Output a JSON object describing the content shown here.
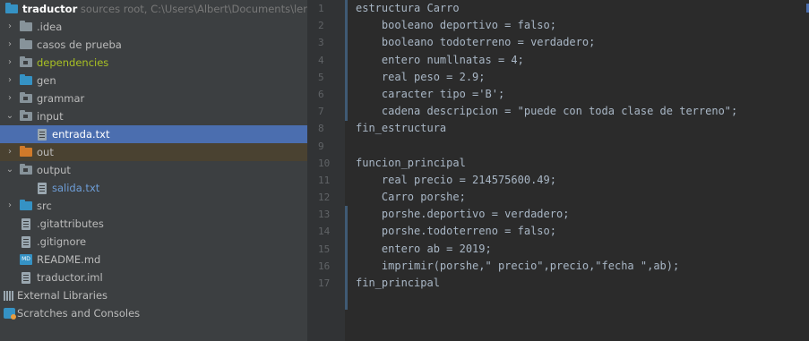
{
  "project_tree": {
    "root": {
      "name": "traductor",
      "path": "sources root, C:\\Users\\Albert\\Documents\\leng"
    },
    "items": [
      {
        "label": "idea",
        "display": ".idea"
      },
      {
        "label": "casos de prueba"
      },
      {
        "label": "dependencies"
      },
      {
        "label": "gen"
      },
      {
        "label": "grammar"
      },
      {
        "label": "input"
      },
      {
        "label": "entrada.txt"
      },
      {
        "label": "out"
      },
      {
        "label": "output"
      },
      {
        "label": "salida.txt"
      },
      {
        "label": "src"
      },
      {
        "label": ".gitattributes"
      },
      {
        "label": ".gitignore"
      },
      {
        "label": "README.md"
      },
      {
        "label": "traductor.iml"
      },
      {
        "label": "External Libraries"
      },
      {
        "label": "Scratches and Consoles"
      }
    ],
    "md_icon_text": "MD"
  },
  "editor": {
    "line_numbers": [
      "1",
      "2",
      "3",
      "4",
      "5",
      "6",
      "7",
      "8",
      "9",
      "10",
      "11",
      "12",
      "13",
      "14",
      "15",
      "16",
      "17"
    ],
    "lines": [
      "estructura Carro",
      "    booleano deportivo = falso;",
      "    booleano todoterreno = verdadero;",
      "    entero numllnatas = 4;",
      "    real peso = 2.9;",
      "    caracter tipo ='B';",
      "    cadena descripcion = \"puede con toda clase de terreno\";",
      "fin_estructura",
      "",
      "funcion_principal",
      "    real precio = 214575600.49;",
      "    Carro porshe;",
      "    porshe.deportivo = verdadero;",
      "    porshe.todoterreno = falso;",
      "    entero ab = 2019;",
      "    imprimir(porshe,\" precio\",precio,\"fecha \",ab);",
      "fin_principal"
    ]
  },
  "colors": {
    "tree_bg": "#3c3f41",
    "selection": "#4b6eaf",
    "editor_bg": "#2b2b2b",
    "code_text": "#a9b7c6",
    "green_label": "#a8c023",
    "lightblue_label": "#6e9ed8"
  }
}
